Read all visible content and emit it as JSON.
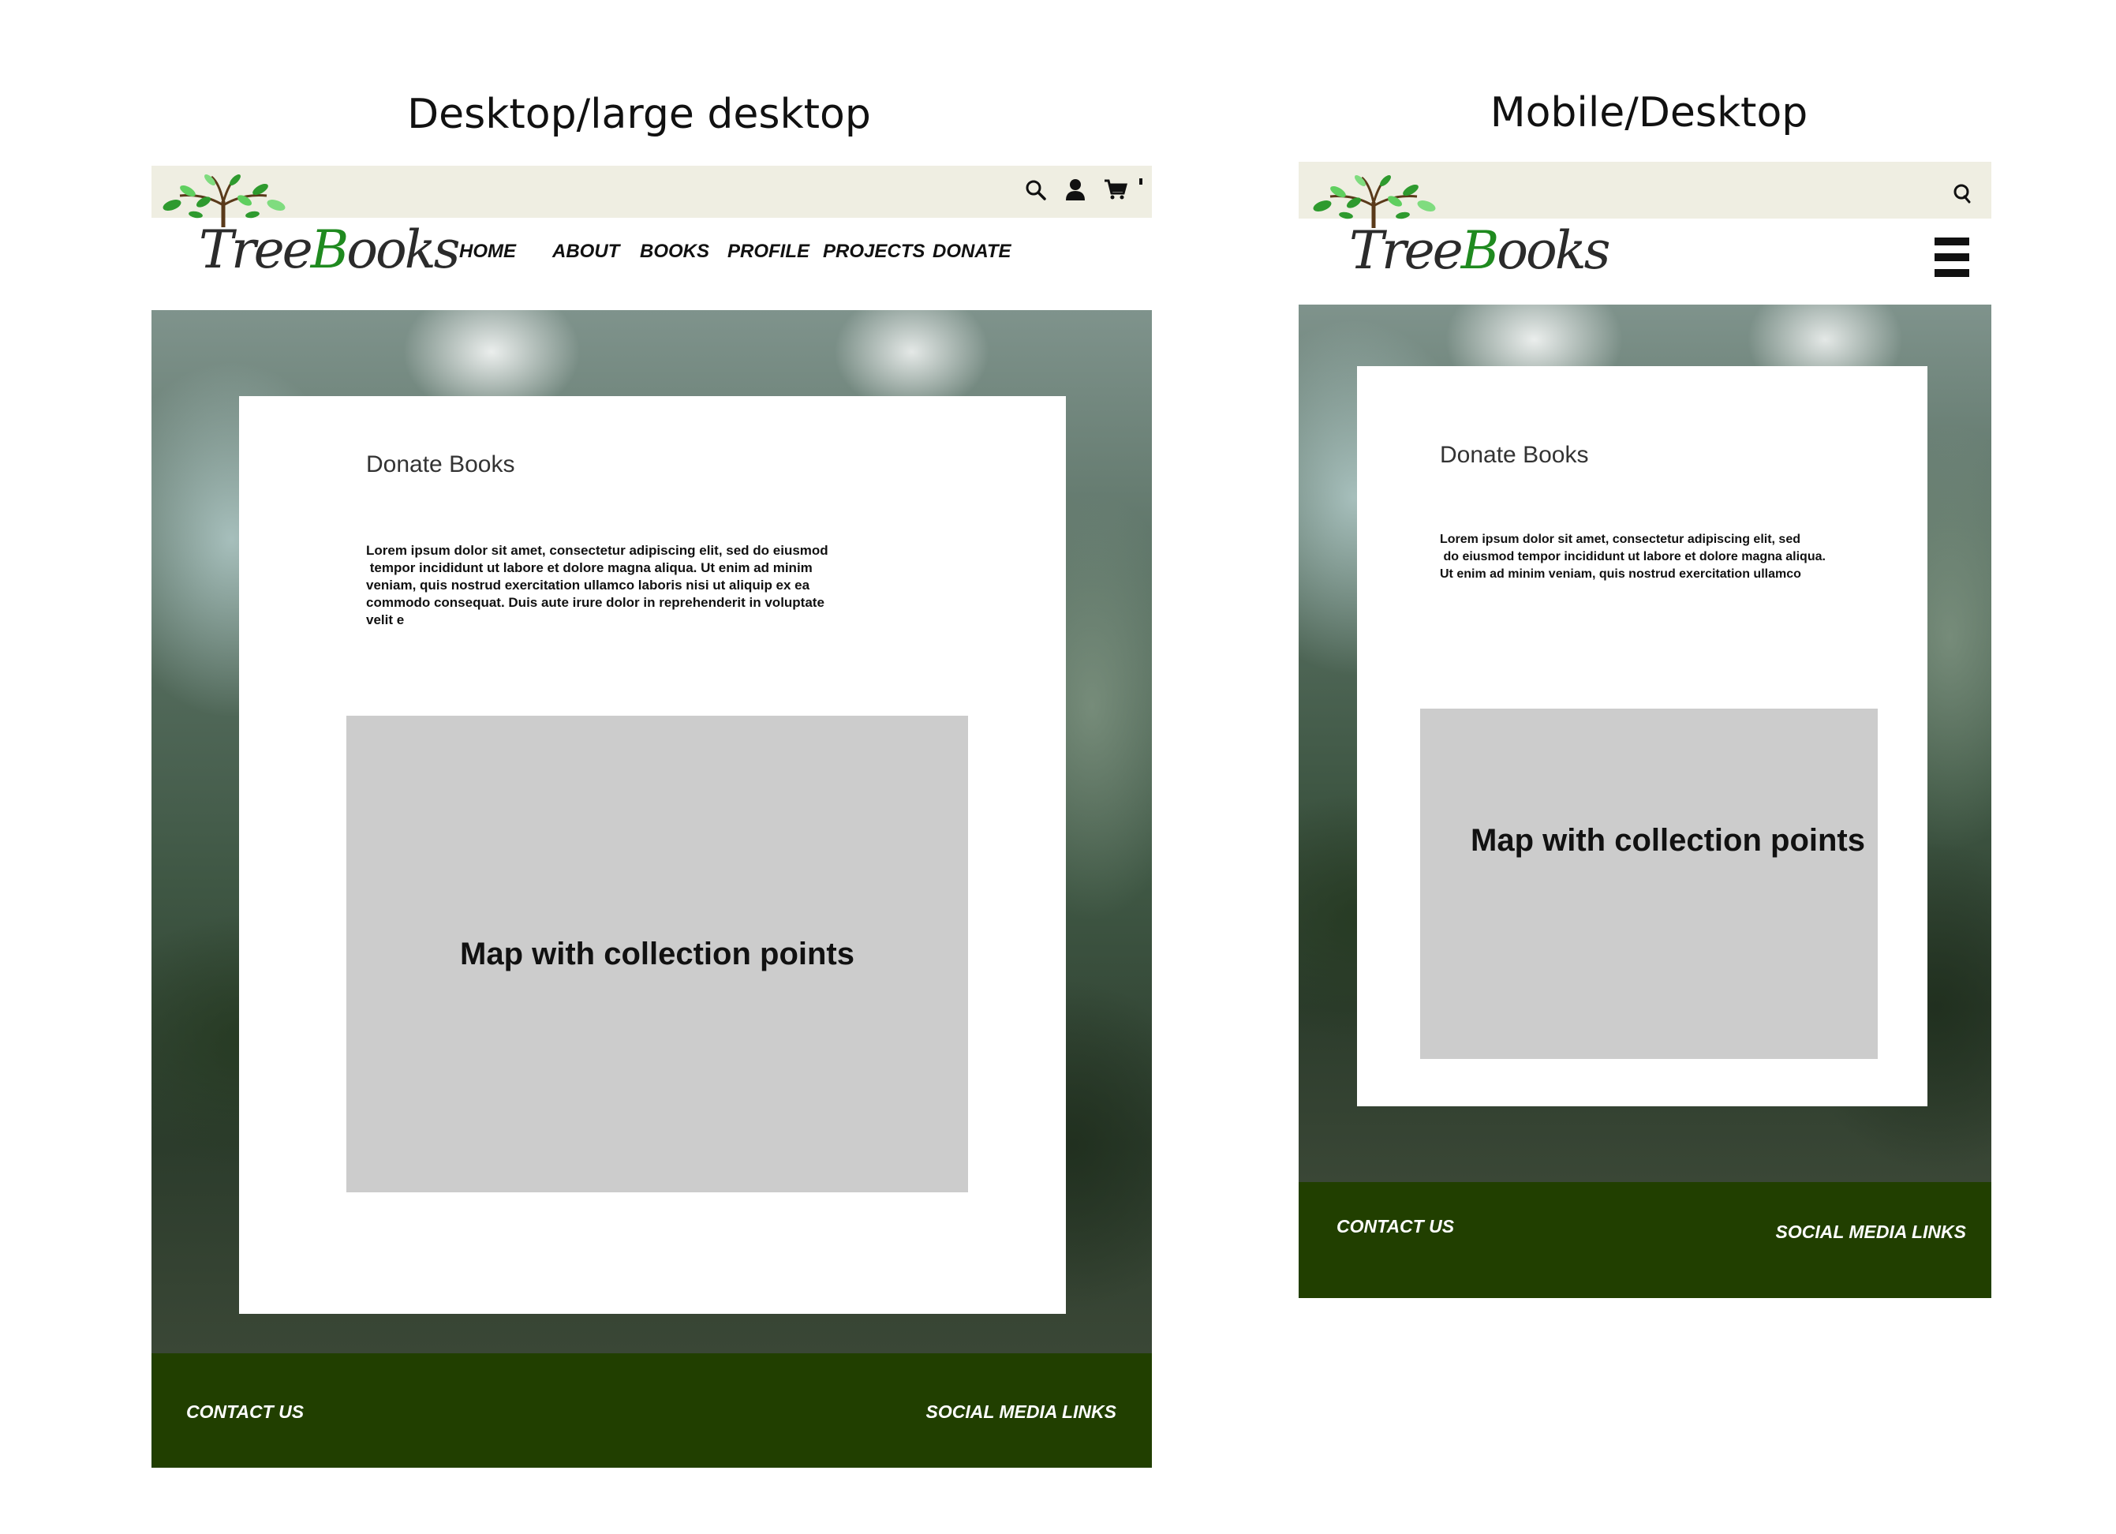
{
  "desktop": {
    "section_title": "Desktop/large desktop",
    "logo": {
      "text_pre": "Tree",
      "text_mid": "B",
      "text_post": "ooks"
    },
    "topbar_icons": [
      "search-icon",
      "user-icon",
      "cart-icon"
    ],
    "nav": [
      "HOME",
      "ABOUT",
      "BOOKS",
      "PROFILE",
      "PROJECTS",
      "DONATE"
    ],
    "card": {
      "title": "Donate Books",
      "body_lines": [
        "Lorem ipsum dolor sit amet, consectetur adipiscing elit, sed do eiusmod",
        " tempor incididunt ut labore et dolore magna aliqua. Ut enim ad minim",
        "veniam, quis nostrud exercitation ullamco laboris nisi ut aliquip ex ea",
        "commodo consequat. Duis aute irure dolor in reprehenderit in voluptate",
        "velit e"
      ],
      "map_label": "Map with collection points"
    },
    "footer": {
      "contact": "CONTACT US",
      "social": "SOCIAL MEDIA LINKS"
    }
  },
  "mobile": {
    "section_title": "Mobile/Desktop",
    "logo": {
      "text_pre": "Tree",
      "text_mid": "B",
      "text_post": "ooks"
    },
    "topbar_icons": [
      "search-icon"
    ],
    "menu_icon": "hamburger-menu-icon",
    "card": {
      "title": "Donate Books",
      "body_lines": [
        "Lorem ipsum dolor sit amet, consectetur adipiscing elit, sed",
        " do eiusmod tempor incididunt ut labore et dolore magna aliqua.",
        "Ut enim ad minim veniam, quis nostrud exercitation ullamco"
      ],
      "map_label": "Map with collection points"
    },
    "footer": {
      "contact": "CONTACT US",
      "social": "SOCIAL MEDIA LINKS"
    }
  },
  "colors": {
    "topbar": "#efeee2",
    "footer": "#213f00",
    "map_placeholder": "#cccccc",
    "card": "#ffffff",
    "logo_green": "#1f8a1f"
  }
}
